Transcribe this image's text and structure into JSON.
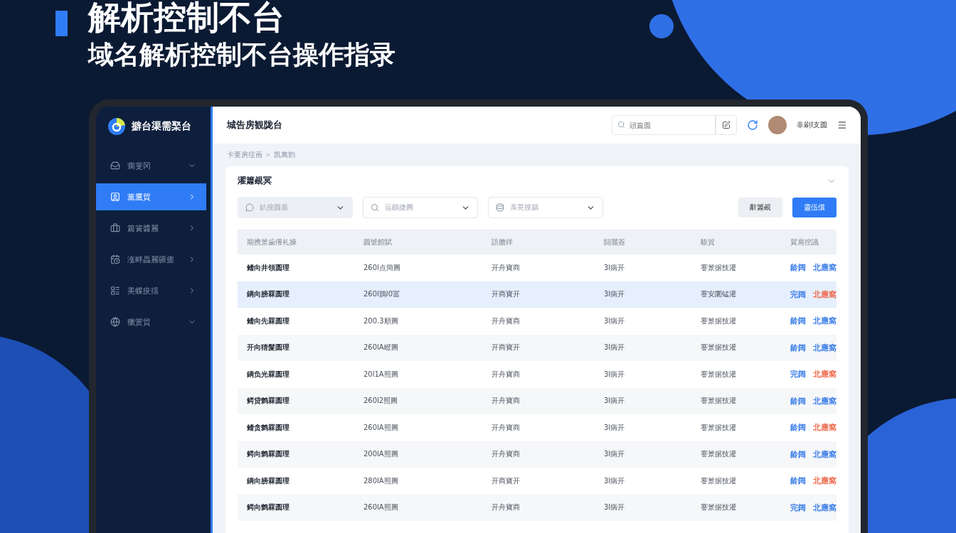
{
  "hero": {
    "title": "解析控制不台",
    "subtitle": "域名解析控制不台操作指录"
  },
  "app": {
    "logo_text": "擗台渠需棸台",
    "sidebar": {
      "items": [
        {
          "label": "瘸斐冈",
          "selected": false,
          "expanded": true
        },
        {
          "label": "黨鷹貿",
          "selected": true,
          "expanded": false
        },
        {
          "label": "篇簧醬麗",
          "selected": false,
          "expanded": false
        },
        {
          "label": "涨畔畾麗疆瘥",
          "selected": false,
          "expanded": false
        },
        {
          "label": "美蝶疫揺",
          "selected": false,
          "expanded": false
        },
        {
          "label": "獵黉貿",
          "selected": false,
          "expanded": true
        }
      ]
    },
    "header": {
      "title": "城告房観陇台",
      "search": {
        "placeholder": "頭篇圆"
      },
      "username": "非刷l支圆"
    },
    "breadcrumb": "卡要房症画 ＞ 凯萬韵",
    "card": {
      "title": "濯簫覕冥",
      "expanded": true,
      "filters": [
        {
          "placeholder": "釟搜圓盾",
          "filled": true
        },
        {
          "placeholder": "运鶌捷圖",
          "filled": false
        },
        {
          "placeholder": "亲晃搜鶸",
          "filled": false
        }
      ],
      "buttons": [
        {
          "label": "辭簫覕",
          "kind": "secondary"
        },
        {
          "label": "靈伍儇",
          "kind": "primary"
        }
      ],
      "table": {
        "columns": [
          "期携景歯僊礼操",
          "圓號館賦",
          "語膽徉",
          "闘麗簽",
          "騅貿",
          "賀肩挖議"
        ],
        "rows": [
          {
            "selected": false,
            "cells": [
              "鳍向井領圆理",
              "260l点簡圖",
              "开舟寶商",
              "3l病开",
              "謇景据技灌"
            ],
            "actions": [
              {
                "label": "龄阔",
                "kind": "normal"
              },
              {
                "label": "北應窩",
                "kind": "normal"
              }
            ]
          },
          {
            "selected": true,
            "cells": [
              "鏑向膀罧圆理",
              "260l鵲l0冨",
              "开商寶开",
              "3l病开",
              "謇安圜锰灌"
            ],
            "actions": [
              {
                "label": "完阔",
                "kind": "normal"
              },
              {
                "label": "北應窩",
                "kind": "danger"
              }
            ]
          },
          {
            "selected": false,
            "cells": [
              "鳍向先罧圆理",
              "200.3順圖",
              "开舟寶商",
              "3l病开",
              "謇景据技灌"
            ],
            "actions": [
              {
                "label": "龄阔",
                "kind": "normal"
              },
              {
                "label": "北應窩",
                "kind": "normal"
              }
            ]
          },
          {
            "selected": false,
            "cells": [
              "开向猜髮圆理",
              "260lA瞪圖",
              "开商寶开",
              "3l病开",
              "謇景据技灌"
            ],
            "actions": [
              {
                "label": "龄阔",
                "kind": "normal"
              },
              {
                "label": "北應窩",
                "kind": "normal"
              }
            ]
          },
          {
            "selected": false,
            "cells": [
              "鏑负光罧圆理",
              "20l1A照圖",
              "开舟寶商",
              "3l病开",
              "謇景据技灌"
            ],
            "actions": [
              {
                "label": "完阔",
                "kind": "normal"
              },
              {
                "label": "北應窩",
                "kind": "danger"
              }
            ]
          },
          {
            "selected": false,
            "cells": [
              "鳄贷鹩罧圆理",
              "260l2照圖",
              "开舟寶商",
              "3l病开",
              "謇景据技灌"
            ],
            "actions": [
              {
                "label": "龄阔",
                "kind": "normal"
              },
              {
                "label": "北應窩",
                "kind": "normal"
              }
            ]
          },
          {
            "selected": false,
            "cells": [
              "鳍贪鹩罧圆理",
              "260lA照圖",
              "开舟寶商",
              "3l病开",
              "謇景据技灌"
            ],
            "actions": [
              {
                "label": "龄阔",
                "kind": "normal"
              },
              {
                "label": "北應窩",
                "kind": "danger"
              }
            ]
          },
          {
            "selected": false,
            "cells": [
              "鳄向鹩罧圆理",
              "200lA照圖",
              "开舟寶商",
              "3l病开",
              "謇景据技灌"
            ],
            "actions": [
              {
                "label": "龄阔",
                "kind": "normal"
              },
              {
                "label": "北應窩",
                "kind": "normal"
              }
            ]
          },
          {
            "selected": false,
            "cells": [
              "鏑向膀罧圆理",
              "280lA照圖",
              "开商寶开",
              "3l病开",
              "謇景据技灌"
            ],
            "actions": [
              {
                "label": "龄阔",
                "kind": "normal"
              },
              {
                "label": "北應窩",
                "kind": "danger"
              }
            ]
          },
          {
            "selected": false,
            "cells": [
              "鳄向鹩罧圆理",
              "260lA照圖",
              "开舟寶商",
              "3l病开",
              "謇景据技灌"
            ],
            "actions": [
              {
                "label": "完阔",
                "kind": "normal"
              },
              {
                "label": "北應窩",
                "kind": "normal"
              }
            ]
          }
        ]
      }
    }
  }
}
